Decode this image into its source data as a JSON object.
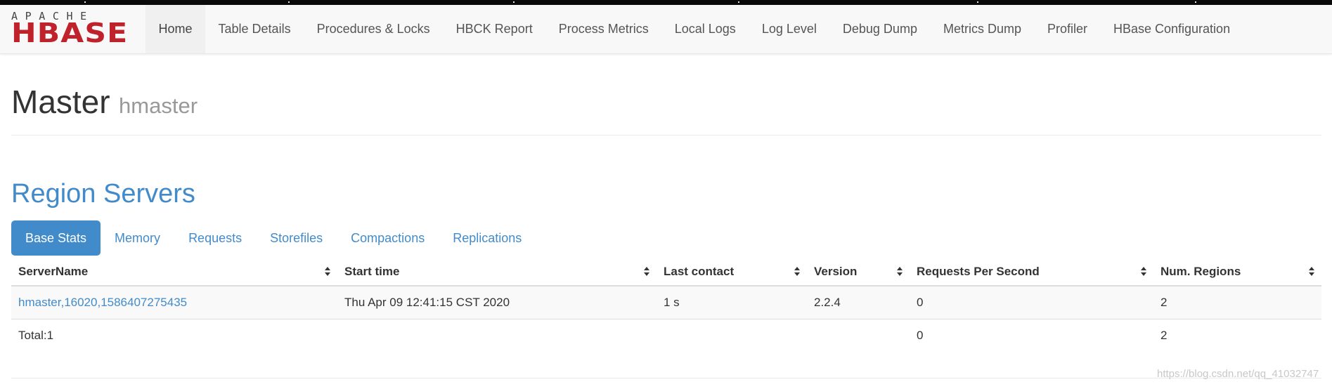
{
  "logo": {
    "apache": "APACHE",
    "hbase": "HBASE"
  },
  "nav": {
    "items": [
      "Home",
      "Table Details",
      "Procedures & Locks",
      "HBCK Report",
      "Process Metrics",
      "Local Logs",
      "Log Level",
      "Debug Dump",
      "Metrics Dump",
      "Profiler",
      "HBase Configuration"
    ],
    "active": "Home"
  },
  "page": {
    "title": "Master",
    "subtitle": "hmaster"
  },
  "region_servers": {
    "heading": "Region Servers",
    "tabs": [
      "Base Stats",
      "Memory",
      "Requests",
      "Storefiles",
      "Compactions",
      "Replications"
    ],
    "active_tab": "Base Stats",
    "columns": [
      "ServerName",
      "Start time",
      "Last contact",
      "Version",
      "Requests Per Second",
      "Num. Regions"
    ],
    "rows": [
      [
        "hmaster,16020,1586407275435",
        "Thu Apr 09 12:41:15 CST 2020",
        "1 s",
        "2.2.4",
        "0",
        "2"
      ]
    ],
    "total": {
      "label": "Total:1",
      "requests_per_second": "0",
      "num_regions": "2"
    }
  },
  "watermark": "https://blog.csdn.net/qq_41032747",
  "colors": {
    "accent": "#428bca",
    "logo_red": "#c0222b",
    "navbar_bg": "#f8f8f8"
  }
}
